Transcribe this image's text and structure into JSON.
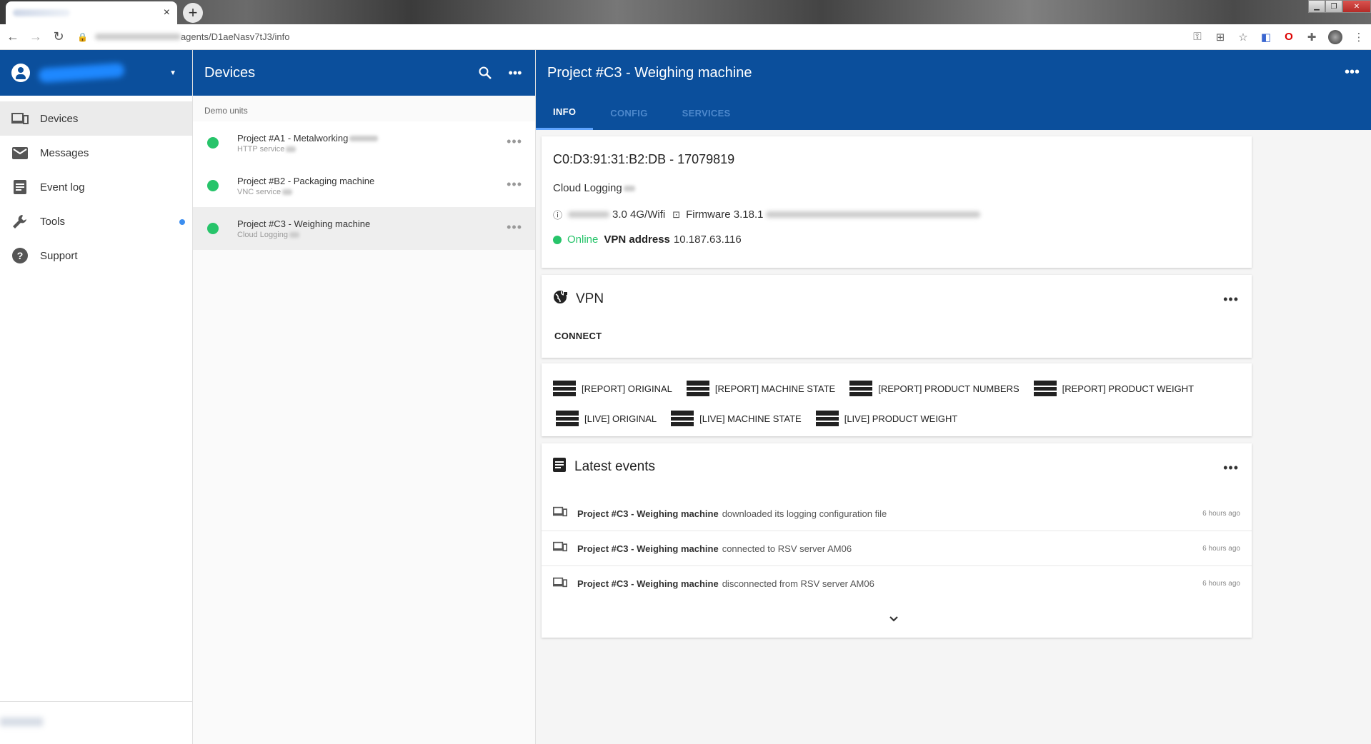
{
  "browser": {
    "url": "agents/D1aeNasv7tJ3/info",
    "new_tab_label": "+",
    "tab_close": "×",
    "window_controls": [
      "▁",
      "❐",
      "✕"
    ]
  },
  "sidebar": {
    "items": [
      {
        "label": "Devices",
        "icon": "devices-icon"
      },
      {
        "label": "Messages",
        "icon": "mail-icon"
      },
      {
        "label": "Event log",
        "icon": "document-icon"
      },
      {
        "label": "Tools",
        "icon": "wrench-icon"
      },
      {
        "label": "Support",
        "icon": "help-icon"
      }
    ]
  },
  "devices": {
    "title": "Devices",
    "group_label": "Demo units",
    "list": [
      {
        "name": "Project #A1 - Metalworking",
        "sub": "HTTP service"
      },
      {
        "name": "Project #B2 - Packaging machine",
        "sub": "VNC service"
      },
      {
        "name": "Project #C3 - Weighing machine",
        "sub": "Cloud Logging"
      }
    ]
  },
  "detail": {
    "title": "Project #C3 - Weighing machine",
    "tabs": [
      "INFO",
      "CONFIG",
      "SERVICES"
    ],
    "info": {
      "device_id": "C0:D3:91:31:B2:DB - 17079819",
      "service": "Cloud Logging",
      "network": "3.0 4G/Wifi",
      "firmware": "Firmware 3.18.1",
      "status": "Online",
      "vpn_label": "VPN address",
      "vpn_address": "10.187.63.116"
    },
    "vpn": {
      "title": "VPN",
      "connect_label": "CONNECT"
    },
    "shortcuts": {
      "row1": [
        "[REPORT] ORIGINAL",
        "[REPORT] MACHINE STATE",
        "[REPORT] PRODUCT NUMBERS",
        "[REPORT] PRODUCT WEIGHT"
      ],
      "row2": [
        "[LIVE] ORIGINAL",
        "[LIVE] MACHINE STATE",
        "[LIVE] PRODUCT WEIGHT"
      ]
    },
    "events": {
      "title": "Latest events",
      "items": [
        {
          "name": "Project #C3 - Weighing machine",
          "desc": "downloaded its logging configuration file",
          "time": "6 hours ago"
        },
        {
          "name": "Project #C3 - Weighing machine",
          "desc": "connected to RSV server AM06",
          "time": "6 hours ago"
        },
        {
          "name": "Project #C3 - Weighing machine",
          "desc": "disconnected from RSV server AM06",
          "time": "6 hours ago"
        }
      ]
    }
  },
  "colors": {
    "primary": "#0b4f9c",
    "online": "#27c46a",
    "notification_dot": "#3c8ef0"
  }
}
